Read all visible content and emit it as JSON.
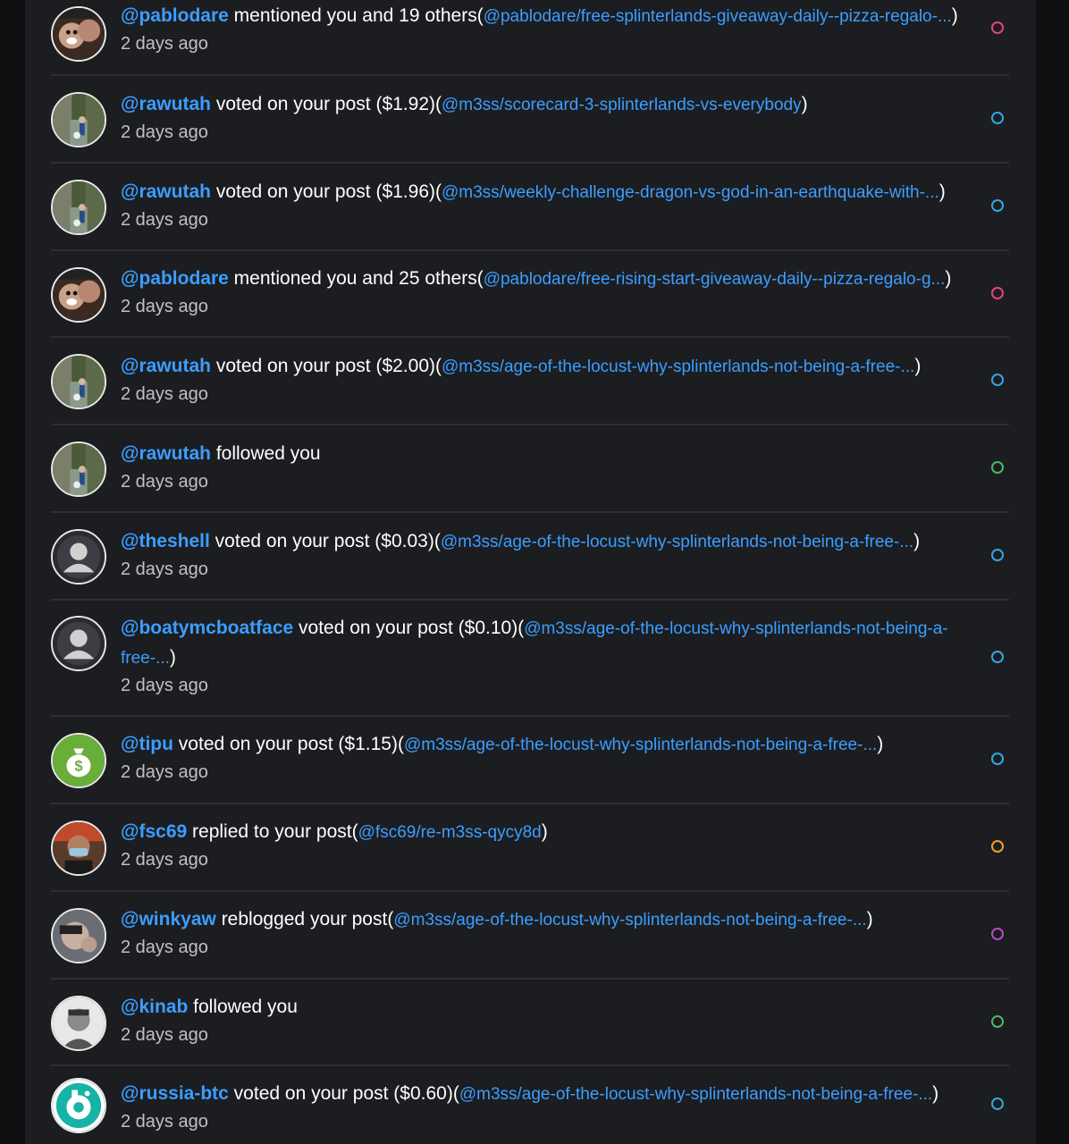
{
  "colors": {
    "mention": "#e2457f",
    "vote": "#32a6e2",
    "follow": "#4cb76a",
    "reply": "#f0a028",
    "reblog": "#b24ec3"
  },
  "notifications": [
    {
      "user": "@pablodare",
      "action": " mentioned you and 19 others(",
      "link": "@pablodare/free-splinterlands-giveaway-daily--pizza-regalo-...",
      "close": ")",
      "time": "2 days ago",
      "type": "mention",
      "avatar": "pablodare"
    },
    {
      "user": "@rawutah",
      "action": " voted on your post ($1.92)(",
      "link": "@m3ss/scorecard-3-splinterlands-vs-everybody",
      "close": ")",
      "time": "2 days ago",
      "type": "vote",
      "avatar": "rawutah"
    },
    {
      "user": "@rawutah",
      "action": " voted on your post ($1.96)(",
      "link": "@m3ss/weekly-challenge-dragon-vs-god-in-an-earthquake-with-...",
      "close": ")",
      "time": "2 days ago",
      "type": "vote",
      "avatar": "rawutah"
    },
    {
      "user": "@pablodare",
      "action": " mentioned you and 25 others(",
      "link": "@pablodare/free-rising-start-giveaway-daily--pizza-regalo-g...",
      "close": ")",
      "time": "2 days ago",
      "type": "mention",
      "avatar": "pablodare"
    },
    {
      "user": "@rawutah",
      "action": " voted on your post ($2.00)(",
      "link": "@m3ss/age-of-the-locust-why-splinterlands-not-being-a-free-...",
      "close": ")",
      "time": "2 days ago",
      "type": "vote",
      "avatar": "rawutah"
    },
    {
      "user": "@rawutah",
      "action": " followed you",
      "link": "",
      "close": "",
      "time": "2 days ago",
      "type": "follow",
      "avatar": "rawutah"
    },
    {
      "user": "@theshell",
      "action": " voted on your post ($0.03)(",
      "link": "@m3ss/age-of-the-locust-why-splinterlands-not-being-a-free-...",
      "close": ")",
      "time": "2 days ago",
      "type": "vote",
      "avatar": "default"
    },
    {
      "user": "@boatymcboatface",
      "action": " voted on your post ($0.10)(",
      "link": "@m3ss/age-of-the-locust-why-splinterlands-not-being-a-free-...",
      "close": ")",
      "time": "2 days ago",
      "type": "vote",
      "avatar": "default"
    },
    {
      "user": "@tipu",
      "action": " voted on your post ($1.15)(",
      "link": "@m3ss/age-of-the-locust-why-splinterlands-not-being-a-free-...",
      "close": ")",
      "time": "2 days ago",
      "type": "vote",
      "avatar": "tipu"
    },
    {
      "user": "@fsc69",
      "action": " replied to your post(",
      "link": "@fsc69/re-m3ss-qycy8d",
      "close": ")",
      "time": "2 days ago",
      "type": "reply",
      "avatar": "fsc69"
    },
    {
      "user": "@winkyaw",
      "action": " reblogged your post(",
      "link": "@m3ss/age-of-the-locust-why-splinterlands-not-being-a-free-...",
      "close": ")",
      "time": "2 days ago",
      "type": "reblog",
      "avatar": "winkyaw"
    },
    {
      "user": "@kinab",
      "action": " followed you",
      "link": "",
      "close": "",
      "time": "2 days ago",
      "type": "follow",
      "avatar": "kinab"
    },
    {
      "user": "@russia-btc",
      "action": " voted on your post ($0.60)(",
      "link": "@m3ss/age-of-the-locust-why-splinterlands-not-being-a-free-...",
      "close": ")",
      "time": "2 days ago",
      "type": "vote",
      "avatar": "russiabtc"
    }
  ]
}
